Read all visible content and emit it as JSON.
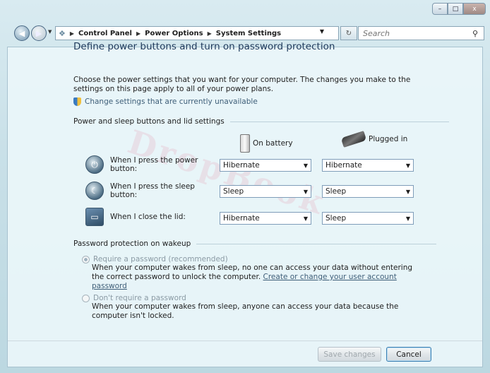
{
  "window": {
    "controls": {
      "minimize": "–",
      "maximize": "□",
      "close": "x"
    }
  },
  "navbar": {
    "back_icon": "◀",
    "forward_icon": "▶",
    "address_icon": "control-panel-icon",
    "breadcrumbs": [
      "Control Panel",
      "Power Options",
      "System Settings"
    ],
    "refresh_icon": "↻",
    "search_placeholder": "Search"
  },
  "page": {
    "title": "Define power buttons and turn on password protection",
    "description": "Choose the power settings that you want for your computer. The changes you make to the settings on this page apply to all of your power plans.",
    "change_settings_link": "Change settings that are currently unavailable",
    "watermark": "DropBook"
  },
  "buttons_section": {
    "heading": "Power and sleep buttons and lid settings",
    "col_battery": "On battery",
    "col_plugged": "Plugged in",
    "rows": [
      {
        "label": "When I press the power button:",
        "battery": "Hibernate",
        "plugged": "Hibernate"
      },
      {
        "label": "When I press the sleep button:",
        "battery": "Sleep",
        "plugged": "Sleep"
      },
      {
        "label": "When I close the lid:",
        "battery": "Hibernate",
        "plugged": "Sleep"
      }
    ]
  },
  "password_section": {
    "heading": "Password protection on wakeup",
    "require": {
      "label": "Require a password (recommended)",
      "desc": "When your computer wakes from sleep, no one can access your data without entering the correct password to unlock the computer.",
      "link": "Create or change your user account password",
      "checked": true
    },
    "dont_require": {
      "label": "Don't require a password",
      "desc": "When your computer wakes from sleep, anyone can access your data because the computer isn't locked.",
      "checked": false
    }
  },
  "footer": {
    "save_label": "Save changes",
    "cancel_label": "Cancel"
  }
}
